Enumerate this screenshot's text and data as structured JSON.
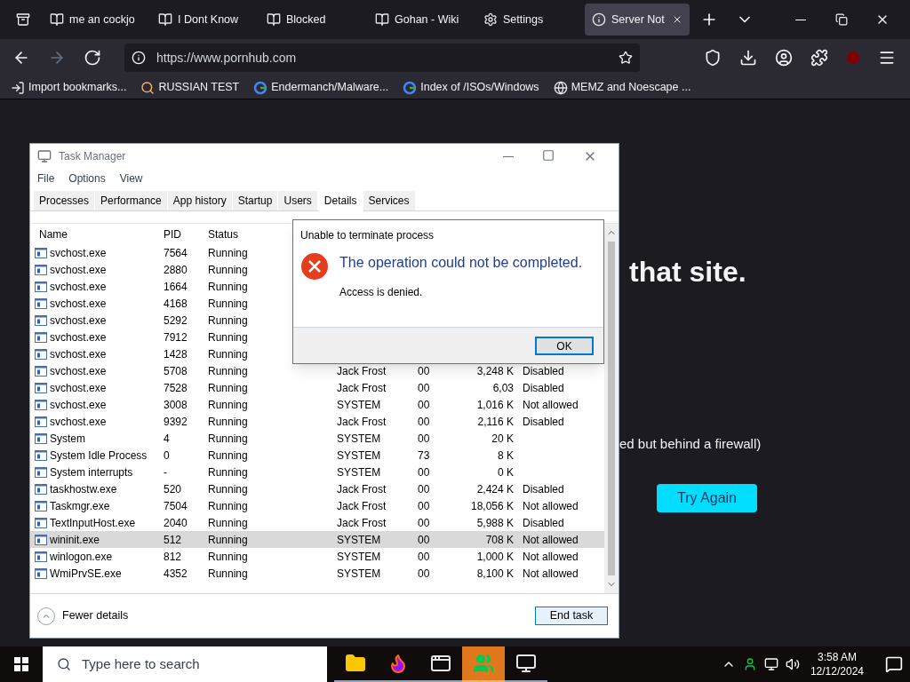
{
  "browser": {
    "tabs": [
      {
        "label": "me an cockjo",
        "kind": "wiki",
        "selected": false
      },
      {
        "label": "I Dont Know",
        "kind": "wiki",
        "selected": false
      },
      {
        "label": "Blocked",
        "kind": "wiki",
        "selected": false
      },
      {
        "label": "Gohan - Wiki",
        "kind": "wiki",
        "selected": false
      },
      {
        "label": "Settings",
        "kind": "gear",
        "selected": false
      },
      {
        "label": "Server Not",
        "kind": "info",
        "selected": true
      }
    ],
    "url": "https://www.pornhub.com",
    "bookmarks": [
      {
        "label": "Import bookmarks...",
        "kind": "import"
      },
      {
        "label": "RUSSIAN TEST",
        "kind": "search"
      },
      {
        "label": "Endermanch/Malware...",
        "kind": "google"
      },
      {
        "label": "Index of /ISOs/Windows",
        "kind": "google"
      },
      {
        "label": "MEMZ and Noescape ...",
        "kind": "globe"
      }
    ]
  },
  "page": {
    "heading": "that site.",
    "note": "ed but behind a firewall)",
    "button": "Try Again"
  },
  "task_manager": {
    "title": "Task Manager",
    "menu": [
      "File",
      "Options",
      "View"
    ],
    "tabs": [
      {
        "label": "Processes",
        "selected": false
      },
      {
        "label": "Performance",
        "selected": false
      },
      {
        "label": "App history",
        "selected": false
      },
      {
        "label": "Startup",
        "selected": false
      },
      {
        "label": "Users",
        "selected": false
      },
      {
        "label": "Details",
        "selected": true
      },
      {
        "label": "Services",
        "selected": false
      }
    ],
    "columns": [
      "Name",
      "PID",
      "Status"
    ],
    "rows": [
      {
        "name": "svchost.exe",
        "pid": "7564",
        "status": "Running",
        "selected": false
      },
      {
        "name": "svchost.exe",
        "pid": "2880",
        "status": "Running",
        "selected": false
      },
      {
        "name": "svchost.exe",
        "pid": "1664",
        "status": "Running",
        "selected": false
      },
      {
        "name": "svchost.exe",
        "pid": "4168",
        "status": "Running",
        "selected": false
      },
      {
        "name": "svchost.exe",
        "pid": "5292",
        "status": "Running",
        "selected": false
      },
      {
        "name": "svchost.exe",
        "pid": "7912",
        "status": "Running",
        "selected": false
      },
      {
        "name": "svchost.exe",
        "pid": "1428",
        "status": "Running",
        "selected": false
      },
      {
        "name": "svchost.exe",
        "pid": "5708",
        "status": "Running",
        "user": "Jack Frost",
        "cpu": "00",
        "memory": "3,248 K",
        "uac": "Disabled",
        "selected": false
      },
      {
        "name": "svchost.exe",
        "pid": "7528",
        "status": "Running",
        "user": "Jack Frost",
        "cpu": "00",
        "memory": "6,03",
        "uac": "Disabled",
        "selected": false
      },
      {
        "name": "svchost.exe",
        "pid": "3008",
        "status": "Running",
        "user": "SYSTEM",
        "cpu": "00",
        "memory": "1,016 K",
        "uac": "Not allowed",
        "selected": false
      },
      {
        "name": "svchost.exe",
        "pid": "9392",
        "status": "Running",
        "user": "Jack Frost",
        "cpu": "00",
        "memory": "2,116 K",
        "uac": "Disabled",
        "selected": false
      },
      {
        "name": "System",
        "pid": "4",
        "status": "Running",
        "user": "SYSTEM",
        "cpu": "00",
        "memory": "20 K",
        "selected": false
      },
      {
        "name": "System Idle Process",
        "pid": "0",
        "status": "Running",
        "user": "SYSTEM",
        "cpu": "73",
        "memory": "8 K",
        "selected": false
      },
      {
        "name": "System interrupts",
        "pid": "-",
        "status": "Running",
        "user": "SYSTEM",
        "cpu": "00",
        "memory": "0 K",
        "selected": false
      },
      {
        "name": "taskhostw.exe",
        "pid": "520",
        "status": "Running",
        "user": "Jack Frost",
        "cpu": "00",
        "memory": "2,424 K",
        "uac": "Disabled",
        "selected": false
      },
      {
        "name": "Taskmgr.exe",
        "pid": "7504",
        "status": "Running",
        "user": "Jack Frost",
        "cpu": "00",
        "memory": "18,056 K",
        "uac": "Not allowed",
        "selected": false
      },
      {
        "name": "TextInputHost.exe",
        "pid": "2040",
        "status": "Running",
        "user": "Jack Frost",
        "cpu": "00",
        "memory": "5,988 K",
        "uac": "Disabled",
        "selected": false
      },
      {
        "name": "wininit.exe",
        "pid": "512",
        "status": "Running",
        "user": "SYSTEM",
        "cpu": "00",
        "memory": "708 K",
        "uac": "Not allowed",
        "selected": true
      },
      {
        "name": "winlogon.exe",
        "pid": "812",
        "status": "Running",
        "user": "SYSTEM",
        "cpu": "00",
        "memory": "1,000 K",
        "uac": "Not allowed",
        "selected": false
      },
      {
        "name": "WmiPrvSE.exe",
        "pid": "4352",
        "status": "Running",
        "user": "SYSTEM",
        "cpu": "00",
        "memory": "8,100 K",
        "uac": "Not allowed",
        "selected": false
      }
    ],
    "fewer_details": "Fewer details",
    "end_task": "End task"
  },
  "dialog": {
    "title": "Unable to terminate process",
    "heading": "The operation could not be completed.",
    "message": "Access is denied.",
    "button": "OK"
  },
  "taskbar": {
    "search_placeholder": "Type here to search",
    "apps": [
      {
        "kind": "folder",
        "selected": false
      },
      {
        "kind": "firefox",
        "selected": false
      },
      {
        "kind": "window",
        "selected": false
      },
      {
        "kind": "people",
        "selected": true
      },
      {
        "kind": "monitor",
        "selected": false
      }
    ],
    "time": "3:58 AM",
    "date": "12/12/2024"
  }
}
